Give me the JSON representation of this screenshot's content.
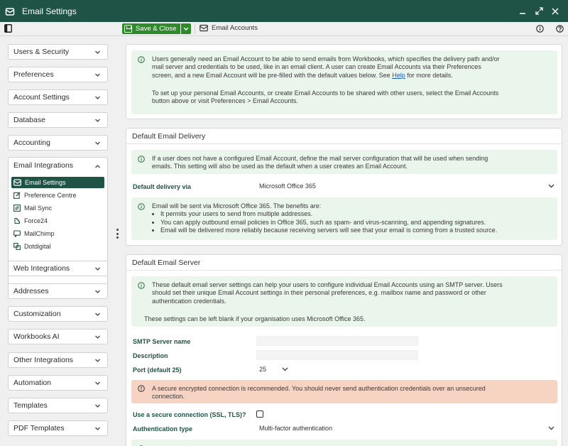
{
  "window": {
    "title": "Email Settings"
  },
  "toolbar": {
    "save_label": "Save & Close",
    "email_accounts_label": "Email Accounts"
  },
  "sidebar": {
    "items_top": [
      {
        "label": "Users & Security"
      },
      {
        "label": "Preferences"
      },
      {
        "label": "Account Settings"
      },
      {
        "label": "Database"
      },
      {
        "label": "Accounting"
      }
    ],
    "open_section": {
      "label": "Email Integrations",
      "children": [
        {
          "label": "Email Settings",
          "icon": "envelope-icon"
        },
        {
          "label": "Preference Centre",
          "icon": "edit-icon"
        },
        {
          "label": "Mail Sync",
          "icon": "sync-icon"
        },
        {
          "label": "Force24",
          "icon": "plugin-icon"
        },
        {
          "label": "MailChimp",
          "icon": "chat-icon"
        },
        {
          "label": "Dotdigital",
          "icon": "link-icon"
        }
      ]
    },
    "items_bottom": [
      {
        "label": "Web Integrations"
      },
      {
        "label": "Addresses"
      },
      {
        "label": "Customization"
      },
      {
        "label": "Workbooks AI"
      },
      {
        "label": "Other Integrations"
      },
      {
        "label": "Automation"
      },
      {
        "label": "Templates"
      },
      {
        "label": "PDF Templates"
      }
    ]
  },
  "intro": {
    "line1": "Users generally need an Email Account to be able to send emails from Workbooks, which specifies the delivery path and/or",
    "line2": "mail server and credentials to be used, like in an email client. A user can create Email Accounts via their Preferences",
    "line3_pre": "screen, and a new Email Account will be pre-filled with the default values below. See ",
    "line3_link": "Help",
    "line3_post": " for more details.",
    "para2_line1": "To set up your personal Email Accounts, or create Email Accounts to be shared with other users, select the Email Accounts",
    "para2_line2": "button above or visit Preferences > Email Accounts."
  },
  "delivery": {
    "heading": "Default Email Delivery",
    "info_line1": "If a user does not have a configured Email Account, define the mail server configuration that will be used when sending",
    "info_line2": "emails. This setting will also be used as the default when a user creates an Email Account.",
    "field_label": "Default delivery via",
    "field_value": "Microsoft Office 365",
    "benefits_intro": "Email will be sent via Microsoft Office 365. The benefits are:",
    "benefits": [
      "It permits your users to send from multiple addresses.",
      "You can apply outbound email policies in Office 365, such as spam- and virus-scanning, and appending signatures.",
      "Email will be delivered more reliably because receiving servers will see that your email is coming from a trusted source."
    ]
  },
  "server": {
    "heading": "Default Email Server",
    "info_line1": "These default email server settings can help your users to configure individual Email Accounts using an SMTP server. Users",
    "info_line2": "should set their unique Email Account settings in their personal preferences, e.g. mailbox name and password or other",
    "info_line3": "authentication credentials.",
    "blank_note": "These settings can be left blank if your organisation uses Microsoft Office 365.",
    "smtp_label": "SMTP Server name",
    "smtp_value": "",
    "description_label": "Description",
    "description_value": "",
    "port_label": "Port (default 25)",
    "port_value": "25",
    "warning_line1": "A secure encrypted connection is recommended. You should never send authentication credentials over an unsecured",
    "warning_line2": "connection.",
    "secure_label": "Use a secure connection (SSL, TLS)?",
    "secure_checked": false,
    "auth_label": "Authentication type",
    "auth_value": "Multi-factor authentication"
  },
  "colors": {
    "titlebar": "#1f5345",
    "accent_green": "#2f8a2a",
    "info_bg": "#eaf5ec",
    "warning_bg": "#f7d3c3"
  }
}
